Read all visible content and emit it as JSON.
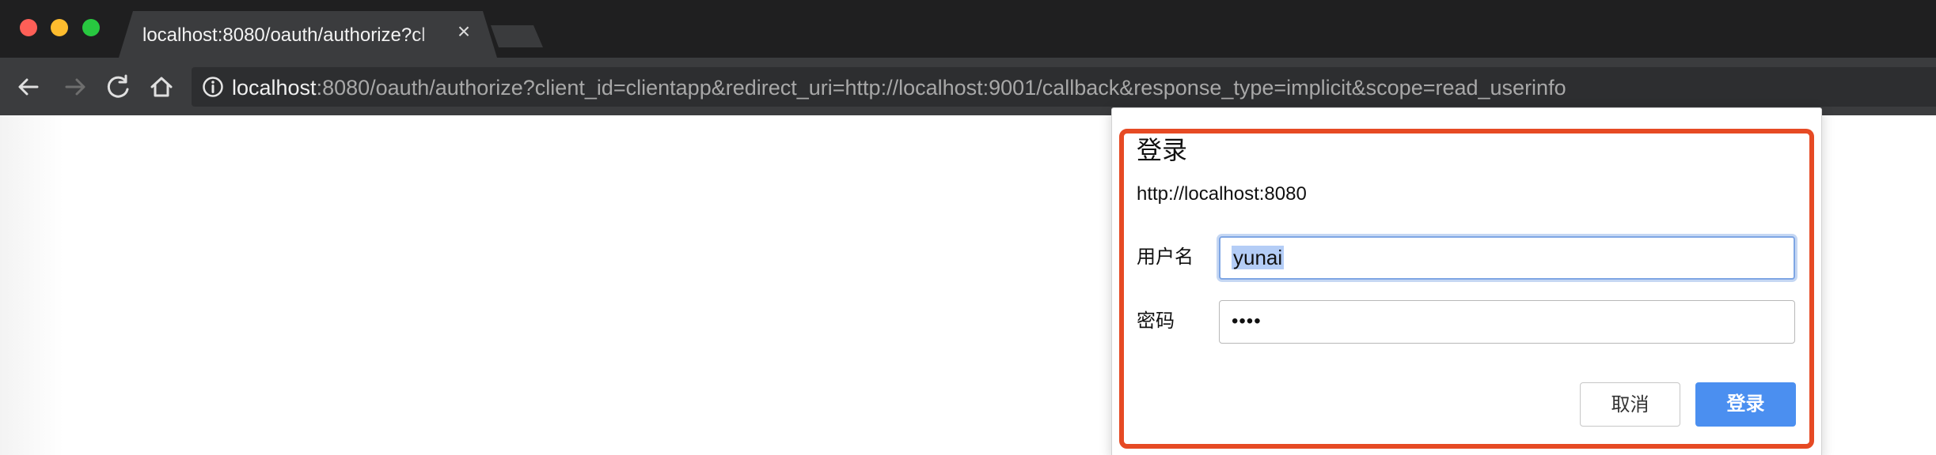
{
  "browser": {
    "tab": {
      "title": "localhost:8080/oauth/authorize?cl",
      "close_symbol": "×"
    },
    "address_bar": {
      "host": "localhost",
      "rest": ":8080/oauth/authorize?client_id=clientapp&redirect_uri=http://localhost:9001/callback&response_type=implicit&scope=read_userinfo"
    },
    "icons": {
      "back": "back-arrow-icon",
      "forward": "forward-arrow-icon",
      "reload": "reload-icon",
      "home": "home-icon",
      "info": "info-icon",
      "close": "close-icon"
    }
  },
  "dialog": {
    "title": "登录",
    "origin": "http://localhost:8080",
    "username_label": "用户名",
    "username_value": "yunai",
    "password_label": "密码",
    "password_value": "••••",
    "cancel_label": "取消",
    "login_label": "登录",
    "highlight_color": "#e64a24",
    "accent": "#4b8ff0"
  }
}
